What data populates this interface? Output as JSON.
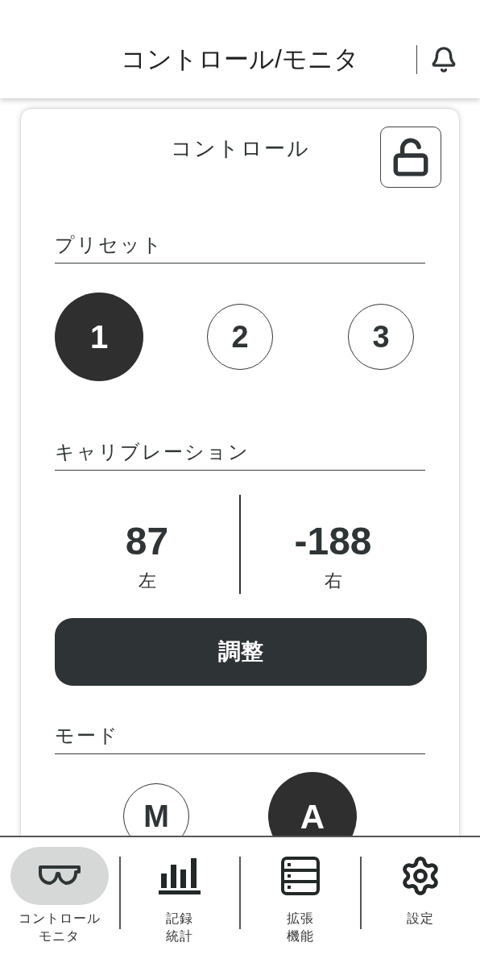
{
  "header": {
    "title": "コントロール/モニタ"
  },
  "card": {
    "title": "コントロール",
    "locked": false,
    "presets": {
      "heading": "プリセット",
      "items": [
        {
          "label": "1",
          "selected": true
        },
        {
          "label": "2",
          "selected": false
        },
        {
          "label": "3",
          "selected": false
        }
      ]
    },
    "calibration": {
      "heading": "キャリブレーション",
      "values": [
        {
          "value": "87",
          "label": "左"
        },
        {
          "value": "-188",
          "label": "右"
        }
      ],
      "button": "調整"
    },
    "mode": {
      "heading": "モード",
      "items": [
        {
          "label": "M",
          "selected": false
        },
        {
          "label": "A",
          "selected": true
        }
      ]
    }
  },
  "nav": [
    {
      "kind": "glasses",
      "lines": [
        "コントロール",
        "モニタ"
      ],
      "selected": true
    },
    {
      "kind": "chart",
      "lines": [
        "記録",
        "統計"
      ],
      "selected": false
    },
    {
      "kind": "list",
      "lines": [
        "拡張",
        "機能"
      ],
      "selected": false
    },
    {
      "kind": "gear",
      "lines": [
        "設定"
      ],
      "selected": false
    }
  ]
}
